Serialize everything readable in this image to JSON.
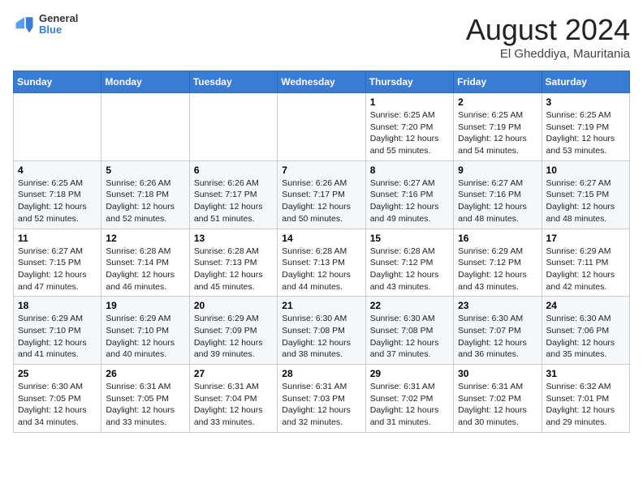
{
  "header": {
    "logo_text1": "General",
    "logo_text2": "Blue",
    "month_title": "August 2024",
    "location": "El Gheddiya, Mauritania"
  },
  "days_of_week": [
    "Sunday",
    "Monday",
    "Tuesday",
    "Wednesday",
    "Thursday",
    "Friday",
    "Saturday"
  ],
  "weeks": [
    [
      {
        "day": "",
        "info": ""
      },
      {
        "day": "",
        "info": ""
      },
      {
        "day": "",
        "info": ""
      },
      {
        "day": "",
        "info": ""
      },
      {
        "day": "1",
        "info": "Sunrise: 6:25 AM\nSunset: 7:20 PM\nDaylight: 12 hours\nand 55 minutes."
      },
      {
        "day": "2",
        "info": "Sunrise: 6:25 AM\nSunset: 7:19 PM\nDaylight: 12 hours\nand 54 minutes."
      },
      {
        "day": "3",
        "info": "Sunrise: 6:25 AM\nSunset: 7:19 PM\nDaylight: 12 hours\nand 53 minutes."
      }
    ],
    [
      {
        "day": "4",
        "info": "Sunrise: 6:25 AM\nSunset: 7:18 PM\nDaylight: 12 hours\nand 52 minutes."
      },
      {
        "day": "5",
        "info": "Sunrise: 6:26 AM\nSunset: 7:18 PM\nDaylight: 12 hours\nand 52 minutes."
      },
      {
        "day": "6",
        "info": "Sunrise: 6:26 AM\nSunset: 7:17 PM\nDaylight: 12 hours\nand 51 minutes."
      },
      {
        "day": "7",
        "info": "Sunrise: 6:26 AM\nSunset: 7:17 PM\nDaylight: 12 hours\nand 50 minutes."
      },
      {
        "day": "8",
        "info": "Sunrise: 6:27 AM\nSunset: 7:16 PM\nDaylight: 12 hours\nand 49 minutes."
      },
      {
        "day": "9",
        "info": "Sunrise: 6:27 AM\nSunset: 7:16 PM\nDaylight: 12 hours\nand 48 minutes."
      },
      {
        "day": "10",
        "info": "Sunrise: 6:27 AM\nSunset: 7:15 PM\nDaylight: 12 hours\nand 48 minutes."
      }
    ],
    [
      {
        "day": "11",
        "info": "Sunrise: 6:27 AM\nSunset: 7:15 PM\nDaylight: 12 hours\nand 47 minutes."
      },
      {
        "day": "12",
        "info": "Sunrise: 6:28 AM\nSunset: 7:14 PM\nDaylight: 12 hours\nand 46 minutes."
      },
      {
        "day": "13",
        "info": "Sunrise: 6:28 AM\nSunset: 7:13 PM\nDaylight: 12 hours\nand 45 minutes."
      },
      {
        "day": "14",
        "info": "Sunrise: 6:28 AM\nSunset: 7:13 PM\nDaylight: 12 hours\nand 44 minutes."
      },
      {
        "day": "15",
        "info": "Sunrise: 6:28 AM\nSunset: 7:12 PM\nDaylight: 12 hours\nand 43 minutes."
      },
      {
        "day": "16",
        "info": "Sunrise: 6:29 AM\nSunset: 7:12 PM\nDaylight: 12 hours\nand 43 minutes."
      },
      {
        "day": "17",
        "info": "Sunrise: 6:29 AM\nSunset: 7:11 PM\nDaylight: 12 hours\nand 42 minutes."
      }
    ],
    [
      {
        "day": "18",
        "info": "Sunrise: 6:29 AM\nSunset: 7:10 PM\nDaylight: 12 hours\nand 41 minutes."
      },
      {
        "day": "19",
        "info": "Sunrise: 6:29 AM\nSunset: 7:10 PM\nDaylight: 12 hours\nand 40 minutes."
      },
      {
        "day": "20",
        "info": "Sunrise: 6:29 AM\nSunset: 7:09 PM\nDaylight: 12 hours\nand 39 minutes."
      },
      {
        "day": "21",
        "info": "Sunrise: 6:30 AM\nSunset: 7:08 PM\nDaylight: 12 hours\nand 38 minutes."
      },
      {
        "day": "22",
        "info": "Sunrise: 6:30 AM\nSunset: 7:08 PM\nDaylight: 12 hours\nand 37 minutes."
      },
      {
        "day": "23",
        "info": "Sunrise: 6:30 AM\nSunset: 7:07 PM\nDaylight: 12 hours\nand 36 minutes."
      },
      {
        "day": "24",
        "info": "Sunrise: 6:30 AM\nSunset: 7:06 PM\nDaylight: 12 hours\nand 35 minutes."
      }
    ],
    [
      {
        "day": "25",
        "info": "Sunrise: 6:30 AM\nSunset: 7:05 PM\nDaylight: 12 hours\nand 34 minutes."
      },
      {
        "day": "26",
        "info": "Sunrise: 6:31 AM\nSunset: 7:05 PM\nDaylight: 12 hours\nand 33 minutes."
      },
      {
        "day": "27",
        "info": "Sunrise: 6:31 AM\nSunset: 7:04 PM\nDaylight: 12 hours\nand 33 minutes."
      },
      {
        "day": "28",
        "info": "Sunrise: 6:31 AM\nSunset: 7:03 PM\nDaylight: 12 hours\nand 32 minutes."
      },
      {
        "day": "29",
        "info": "Sunrise: 6:31 AM\nSunset: 7:02 PM\nDaylight: 12 hours\nand 31 minutes."
      },
      {
        "day": "30",
        "info": "Sunrise: 6:31 AM\nSunset: 7:02 PM\nDaylight: 12 hours\nand 30 minutes."
      },
      {
        "day": "31",
        "info": "Sunrise: 6:32 AM\nSunset: 7:01 PM\nDaylight: 12 hours\nand 29 minutes."
      }
    ]
  ]
}
